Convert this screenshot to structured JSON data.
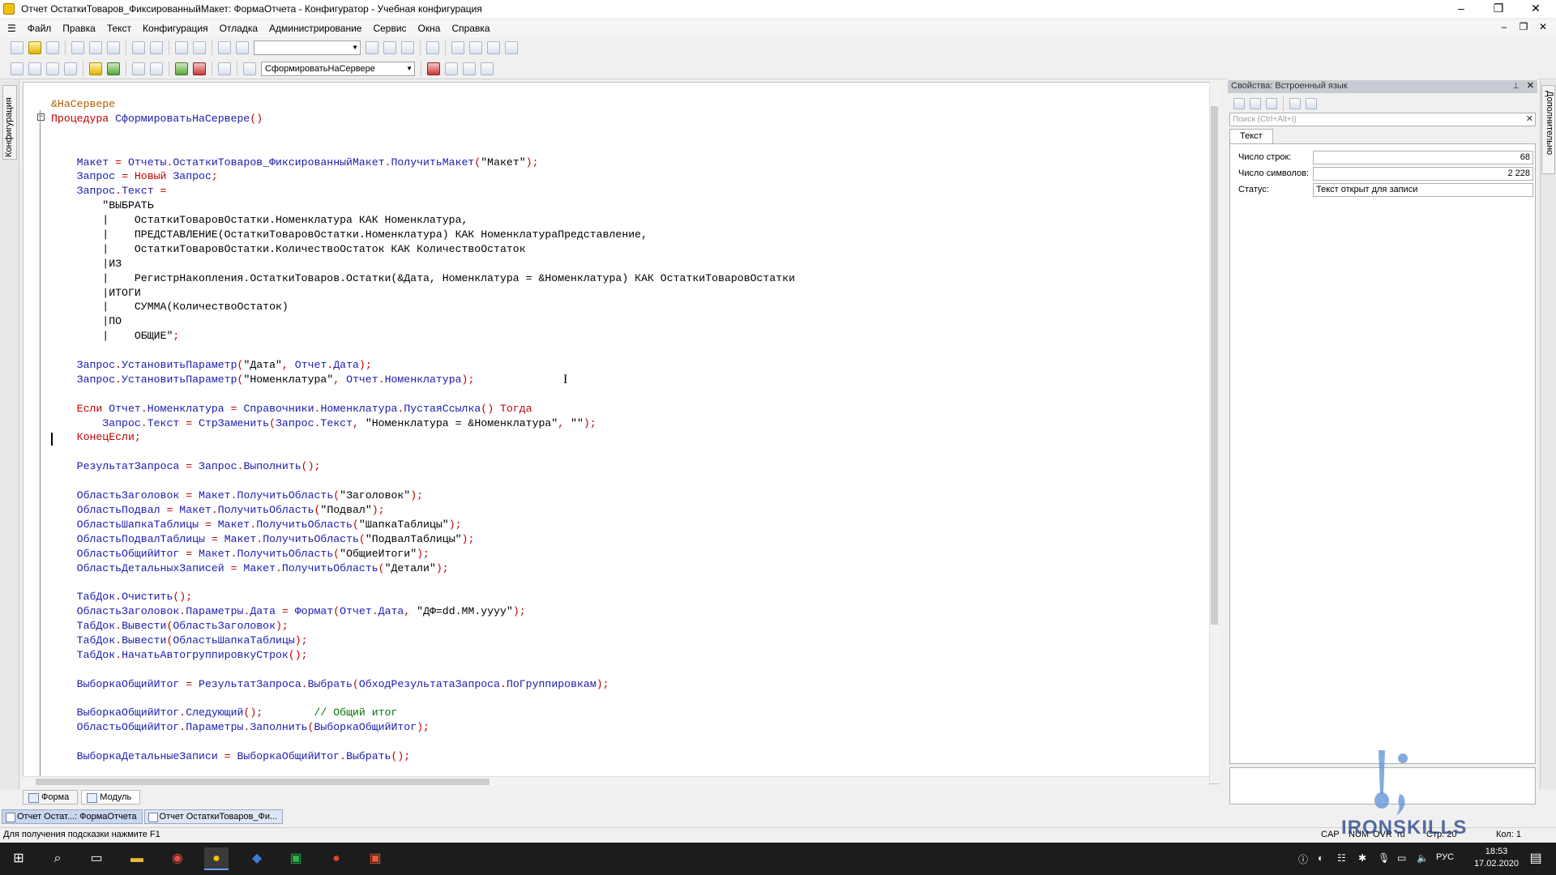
{
  "window": {
    "title": "Отчет ОстаткиТоваров_ФиксированныйМакет: ФормаОтчета - Конфигуратор - Учебная конфигурация",
    "controls": [
      "–",
      "❐",
      "✕"
    ]
  },
  "menu": {
    "items": [
      "Файл",
      "Правка",
      "Текст",
      "Конфигурация",
      "Отладка",
      "Администрирование",
      "Сервис",
      "Окна",
      "Справка"
    ]
  },
  "toolbar2": {
    "procedure_combo": "СформироватьНаСервере"
  },
  "left_panel": {
    "label": "Конфигурация"
  },
  "right_strip": {
    "label": "Дополнительно"
  },
  "code_lines": [
    [
      [
        "&НаСервере",
        "pd"
      ]
    ],
    [
      [
        "Процедура ",
        "kw"
      ],
      [
        "СформироватьНаСервере",
        "nm"
      ],
      [
        "()",
        "kw"
      ]
    ],
    [],
    [],
    [
      [
        "    Макет ",
        "nm"
      ],
      [
        "= ",
        "kw"
      ],
      [
        "Отчеты",
        "nm"
      ],
      [
        ".",
        "kw"
      ],
      [
        "ОстаткиТоваров_ФиксированныйМакет",
        "nm"
      ],
      [
        ".",
        "kw"
      ],
      [
        "ПолучитьМакет",
        "nm"
      ],
      [
        "(",
        "kw"
      ],
      [
        "\"Макет\"",
        "str"
      ],
      [
        ");",
        "kw"
      ]
    ],
    [
      [
        "    Запрос ",
        "nm"
      ],
      [
        "= ",
        "kw"
      ],
      [
        "Новый ",
        "kw"
      ],
      [
        "Запрос",
        "nm"
      ],
      [
        ";",
        "kw"
      ]
    ],
    [
      [
        "    Запрос",
        "nm"
      ],
      [
        ".",
        "kw"
      ],
      [
        "Текст ",
        "nm"
      ],
      [
        "=",
        "kw"
      ]
    ],
    [
      [
        "        \"ВЫБРАТЬ",
        "str"
      ]
    ],
    [
      [
        "        |    ОстаткиТоваровОстатки.Номенклатура КАК Номенклатура,",
        "str"
      ]
    ],
    [
      [
        "        |    ПРЕДСТАВЛЕНИЕ(ОстаткиТоваровОстатки.Номенклатура) КАК НоменклатураПредставление,",
        "str"
      ]
    ],
    [
      [
        "        |    ОстаткиТоваровОстатки.КоличествоОстаток КАК КоличествоОстаток",
        "str"
      ]
    ],
    [
      [
        "        |ИЗ",
        "str"
      ]
    ],
    [
      [
        "        |    РегистрНакопления.ОстаткиТоваров.Остатки(&Дата, Номенклатура = &Номенклатура) КАК ОстаткиТоваровОстатки",
        "str"
      ]
    ],
    [
      [
        "        |ИТОГИ",
        "str"
      ]
    ],
    [
      [
        "        |    СУММА(КоличествоОстаток)",
        "str"
      ]
    ],
    [
      [
        "        |ПО",
        "str"
      ]
    ],
    [
      [
        "        |    ОБЩИЕ\"",
        "str"
      ],
      [
        ";",
        "kw"
      ]
    ],
    [],
    [
      [
        "    Запрос",
        "nm"
      ],
      [
        ".",
        "kw"
      ],
      [
        "УстановитьПараметр",
        "nm"
      ],
      [
        "(",
        "kw"
      ],
      [
        "\"Дата\"",
        "str"
      ],
      [
        ", ",
        "kw"
      ],
      [
        "Отчет",
        "nm"
      ],
      [
        ".",
        "kw"
      ],
      [
        "Дата",
        "nm"
      ],
      [
        ");",
        "kw"
      ]
    ],
    [
      [
        "    Запрос",
        "nm"
      ],
      [
        ".",
        "kw"
      ],
      [
        "УстановитьПараметр",
        "nm"
      ],
      [
        "(",
        "kw"
      ],
      [
        "\"Номенклатура\"",
        "str"
      ],
      [
        ", ",
        "kw"
      ],
      [
        "Отчет",
        "nm"
      ],
      [
        ".",
        "kw"
      ],
      [
        "Номенклатура",
        "nm"
      ],
      [
        ");",
        "kw"
      ]
    ],
    [],
    [
      [
        "    Если ",
        "kw"
      ],
      [
        "Отчет",
        "nm"
      ],
      [
        ".",
        "kw"
      ],
      [
        "Номенклатура ",
        "nm"
      ],
      [
        "= ",
        "kw"
      ],
      [
        "Справочники",
        "nm"
      ],
      [
        ".",
        "kw"
      ],
      [
        "Номенклатура",
        "nm"
      ],
      [
        ".",
        "kw"
      ],
      [
        "ПустаяСсылка",
        "nm"
      ],
      [
        "() ",
        "kw"
      ],
      [
        "Тогда",
        "kw"
      ]
    ],
    [
      [
        "        Запрос",
        "nm"
      ],
      [
        ".",
        "kw"
      ],
      [
        "Текст ",
        "nm"
      ],
      [
        "= ",
        "kw"
      ],
      [
        "СтрЗаменить",
        "nm"
      ],
      [
        "(",
        "kw"
      ],
      [
        "Запрос",
        "nm"
      ],
      [
        ".",
        "kw"
      ],
      [
        "Текст",
        "nm"
      ],
      [
        ", ",
        "kw"
      ],
      [
        "\"Номенклатура = &Номенклатура\"",
        "str"
      ],
      [
        ", ",
        "kw"
      ],
      [
        "\"\"",
        "str"
      ],
      [
        ");",
        "kw"
      ]
    ],
    [
      [
        "    КонецЕсли",
        "kw"
      ],
      [
        ";",
        "kw"
      ]
    ],
    [],
    [
      [
        "    РезультатЗапроса ",
        "nm"
      ],
      [
        "= ",
        "kw"
      ],
      [
        "Запрос",
        "nm"
      ],
      [
        ".",
        "kw"
      ],
      [
        "Выполнить",
        "nm"
      ],
      [
        "();",
        "kw"
      ]
    ],
    [],
    [
      [
        "    ОбластьЗаголовок ",
        "nm"
      ],
      [
        "= ",
        "kw"
      ],
      [
        "Макет",
        "nm"
      ],
      [
        ".",
        "kw"
      ],
      [
        "ПолучитьОбласть",
        "nm"
      ],
      [
        "(",
        "kw"
      ],
      [
        "\"Заголовок\"",
        "str"
      ],
      [
        ");",
        "kw"
      ]
    ],
    [
      [
        "    ОбластьПодвал ",
        "nm"
      ],
      [
        "= ",
        "kw"
      ],
      [
        "Макет",
        "nm"
      ],
      [
        ".",
        "kw"
      ],
      [
        "ПолучитьОбласть",
        "nm"
      ],
      [
        "(",
        "kw"
      ],
      [
        "\"Подвал\"",
        "str"
      ],
      [
        ");",
        "kw"
      ]
    ],
    [
      [
        "    ОбластьШапкаТаблицы ",
        "nm"
      ],
      [
        "= ",
        "kw"
      ],
      [
        "Макет",
        "nm"
      ],
      [
        ".",
        "kw"
      ],
      [
        "ПолучитьОбласть",
        "nm"
      ],
      [
        "(",
        "kw"
      ],
      [
        "\"ШапкаТаблицы\"",
        "str"
      ],
      [
        ");",
        "kw"
      ]
    ],
    [
      [
        "    ОбластьПодвалТаблицы ",
        "nm"
      ],
      [
        "= ",
        "kw"
      ],
      [
        "Макет",
        "nm"
      ],
      [
        ".",
        "kw"
      ],
      [
        "ПолучитьОбласть",
        "nm"
      ],
      [
        "(",
        "kw"
      ],
      [
        "\"ПодвалТаблицы\"",
        "str"
      ],
      [
        ");",
        "kw"
      ]
    ],
    [
      [
        "    ОбластьОбщийИтог ",
        "nm"
      ],
      [
        "= ",
        "kw"
      ],
      [
        "Макет",
        "nm"
      ],
      [
        ".",
        "kw"
      ],
      [
        "ПолучитьОбласть",
        "nm"
      ],
      [
        "(",
        "kw"
      ],
      [
        "\"ОбщиеИтоги\"",
        "str"
      ],
      [
        ");",
        "kw"
      ]
    ],
    [
      [
        "    ОбластьДетальныхЗаписей ",
        "nm"
      ],
      [
        "= ",
        "kw"
      ],
      [
        "Макет",
        "nm"
      ],
      [
        ".",
        "kw"
      ],
      [
        "ПолучитьОбласть",
        "nm"
      ],
      [
        "(",
        "kw"
      ],
      [
        "\"Детали\"",
        "str"
      ],
      [
        ");",
        "kw"
      ]
    ],
    [],
    [
      [
        "    ТабДок",
        "nm"
      ],
      [
        ".",
        "kw"
      ],
      [
        "Очистить",
        "nm"
      ],
      [
        "();",
        "kw"
      ]
    ],
    [
      [
        "    ОбластьЗаголовок",
        "nm"
      ],
      [
        ".",
        "kw"
      ],
      [
        "Параметры",
        "nm"
      ],
      [
        ".",
        "kw"
      ],
      [
        "Дата ",
        "nm"
      ],
      [
        "= ",
        "kw"
      ],
      [
        "Формат",
        "nm"
      ],
      [
        "(",
        "kw"
      ],
      [
        "Отчет",
        "nm"
      ],
      [
        ".",
        "kw"
      ],
      [
        "Дата",
        "nm"
      ],
      [
        ", ",
        "kw"
      ],
      [
        "\"ДФ=dd.MM.yyyy\"",
        "str"
      ],
      [
        ");",
        "kw"
      ]
    ],
    [
      [
        "    ТабДок",
        "nm"
      ],
      [
        ".",
        "kw"
      ],
      [
        "Вывести",
        "nm"
      ],
      [
        "(",
        "kw"
      ],
      [
        "ОбластьЗаголовок",
        "nm"
      ],
      [
        ");",
        "kw"
      ]
    ],
    [
      [
        "    ТабДок",
        "nm"
      ],
      [
        ".",
        "kw"
      ],
      [
        "Вывести",
        "nm"
      ],
      [
        "(",
        "kw"
      ],
      [
        "ОбластьШапкаТаблицы",
        "nm"
      ],
      [
        ");",
        "kw"
      ]
    ],
    [
      [
        "    ТабДок",
        "nm"
      ],
      [
        ".",
        "kw"
      ],
      [
        "НачатьАвтогруппировкуСтрок",
        "nm"
      ],
      [
        "();",
        "kw"
      ]
    ],
    [],
    [
      [
        "    ВыборкаОбщийИтог ",
        "nm"
      ],
      [
        "= ",
        "kw"
      ],
      [
        "РезультатЗапроса",
        "nm"
      ],
      [
        ".",
        "kw"
      ],
      [
        "Выбрать",
        "nm"
      ],
      [
        "(",
        "kw"
      ],
      [
        "ОбходРезультатаЗапроса",
        "nm"
      ],
      [
        ".",
        "kw"
      ],
      [
        "ПоГруппировкам",
        "nm"
      ],
      [
        ");",
        "kw"
      ]
    ],
    [],
    [
      [
        "    ВыборкаОбщийИтог",
        "nm"
      ],
      [
        ".",
        "kw"
      ],
      [
        "Следующий",
        "nm"
      ],
      [
        "();        ",
        "kw"
      ],
      [
        "// Общий итог",
        "cm"
      ]
    ],
    [
      [
        "    ОбластьОбщийИтог",
        "nm"
      ],
      [
        ".",
        "kw"
      ],
      [
        "Параметры",
        "nm"
      ],
      [
        ".",
        "kw"
      ],
      [
        "Заполнить",
        "nm"
      ],
      [
        "(",
        "kw"
      ],
      [
        "ВыборкаОбщийИтог",
        "nm"
      ],
      [
        ");",
        "kw"
      ]
    ],
    [],
    [
      [
        "    ВыборкаДетальныеЗаписи ",
        "nm"
      ],
      [
        "= ",
        "kw"
      ],
      [
        "ВыборкаОбщийИтог",
        "nm"
      ],
      [
        ".",
        "kw"
      ],
      [
        "Выбрать",
        "nm"
      ],
      [
        "();",
        "kw"
      ]
    ]
  ],
  "editor_tabs": [
    "Форма",
    "Модуль"
  ],
  "window_tabs": [
    "Отчет Остат...: ФормаОтчета",
    "Отчет ОстаткиТоваров_Фи..."
  ],
  "properties_panel": {
    "title": "Свойства: Встроенный язык",
    "search_placeholder": "Поиск (Ctrl+Alt+I)",
    "tab": "Текст",
    "rows": [
      {
        "label": "Число строк:",
        "value": "68",
        "numeric": true
      },
      {
        "label": "Число символов:",
        "value": "2 228",
        "numeric": true
      },
      {
        "label": "Статус:",
        "value": "Текст открыт для записи",
        "numeric": false
      }
    ]
  },
  "statusbar": {
    "hint": "Для получения подсказки нажмите F1",
    "indicators": [
      "CAP",
      "NUM",
      "OVR",
      "ru",
      "Стр: 20",
      "Кол: 1"
    ]
  },
  "watermark": {
    "text": "IRONSKILLS"
  },
  "taskbar": {
    "lang": "РУС",
    "time": "18:53",
    "date": "17.02.2020"
  }
}
